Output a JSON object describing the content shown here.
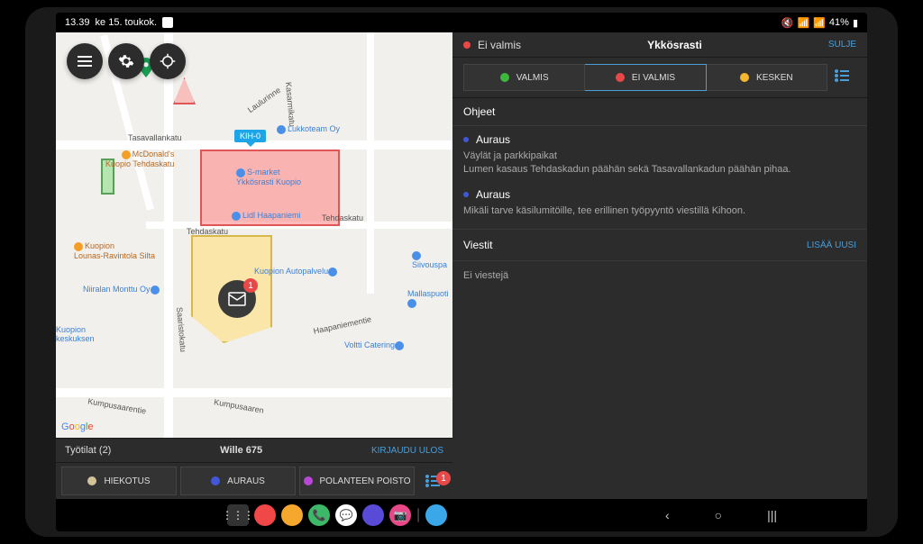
{
  "status_bar": {
    "time": "13.39",
    "date": "ke 15. toukok.",
    "battery": "41%"
  },
  "map": {
    "tag": "KIH-0",
    "msg_badge": "1",
    "attribution": "Google",
    "labels": {
      "tasavallankatu": "Tasavallankatu",
      "tehdaskatu": "Tehdaskatu",
      "tehdaskatu2": "Tehdaskatu",
      "saaristokatu": "Saaristokatu",
      "kumpusaarentie": "Kumpusaarentie",
      "kumpusaaren2": "Kumpusaaren",
      "haapaniementie": "Haapaniementie",
      "kasarmikatu": "Kasarmikatu",
      "laulurinne": "Laulurinne"
    },
    "pois": {
      "mcdonalds": "McDonald's\nKuopio Tehdaskatu",
      "smarket": "S-market\nYkkösrasti Kuopio",
      "lukko": "Lukkoteam Oy",
      "lidl": "Lidl Haapaniemi",
      "siivous": "Siivouspa",
      "autopalvelu": "Kuopion Autopalvelu",
      "mallaspuoti": "Mallaspuoti",
      "voltti": "Voltti Catering",
      "lounas": "Kuopion\nLounas-Ravintola Silta",
      "monttu": "Niiralan Monttu Oy",
      "keskus": "Kuopion\nkeskuksen"
    }
  },
  "info_bar": {
    "workspaces": "Työtilat (2)",
    "vehicle": "Wille 675",
    "logout": "KIRJAUDU ULOS"
  },
  "activities": {
    "sanding": "HIEKOTUS",
    "plowing": "AURAUS",
    "removal": "POLANTEEN POISTO",
    "badge": "1"
  },
  "panel": {
    "status": "Ei valmis",
    "title": "Ykkösrasti",
    "close": "SULJE",
    "tabs": {
      "done": "VALMIS",
      "not_done": "EI VALMIS",
      "in_progress": "KESKEN"
    },
    "instructions_title": "Ohjeet",
    "instructions": [
      {
        "title": "Auraus",
        "line1": "Väylät ja parkkipaikat",
        "line2": "Lumen kasaus Tehdaskadun päähän sekä Tasavallankadun päähän pihaa."
      },
      {
        "title": "Auraus",
        "line1": "Mikäli tarve käsilumitöille, tee erillinen työpyyntö viestillä Kihoon."
      }
    ],
    "messages_title": "Viestit",
    "add_new": "LISÄÄ UUSI",
    "no_messages": "Ei viestejä"
  }
}
